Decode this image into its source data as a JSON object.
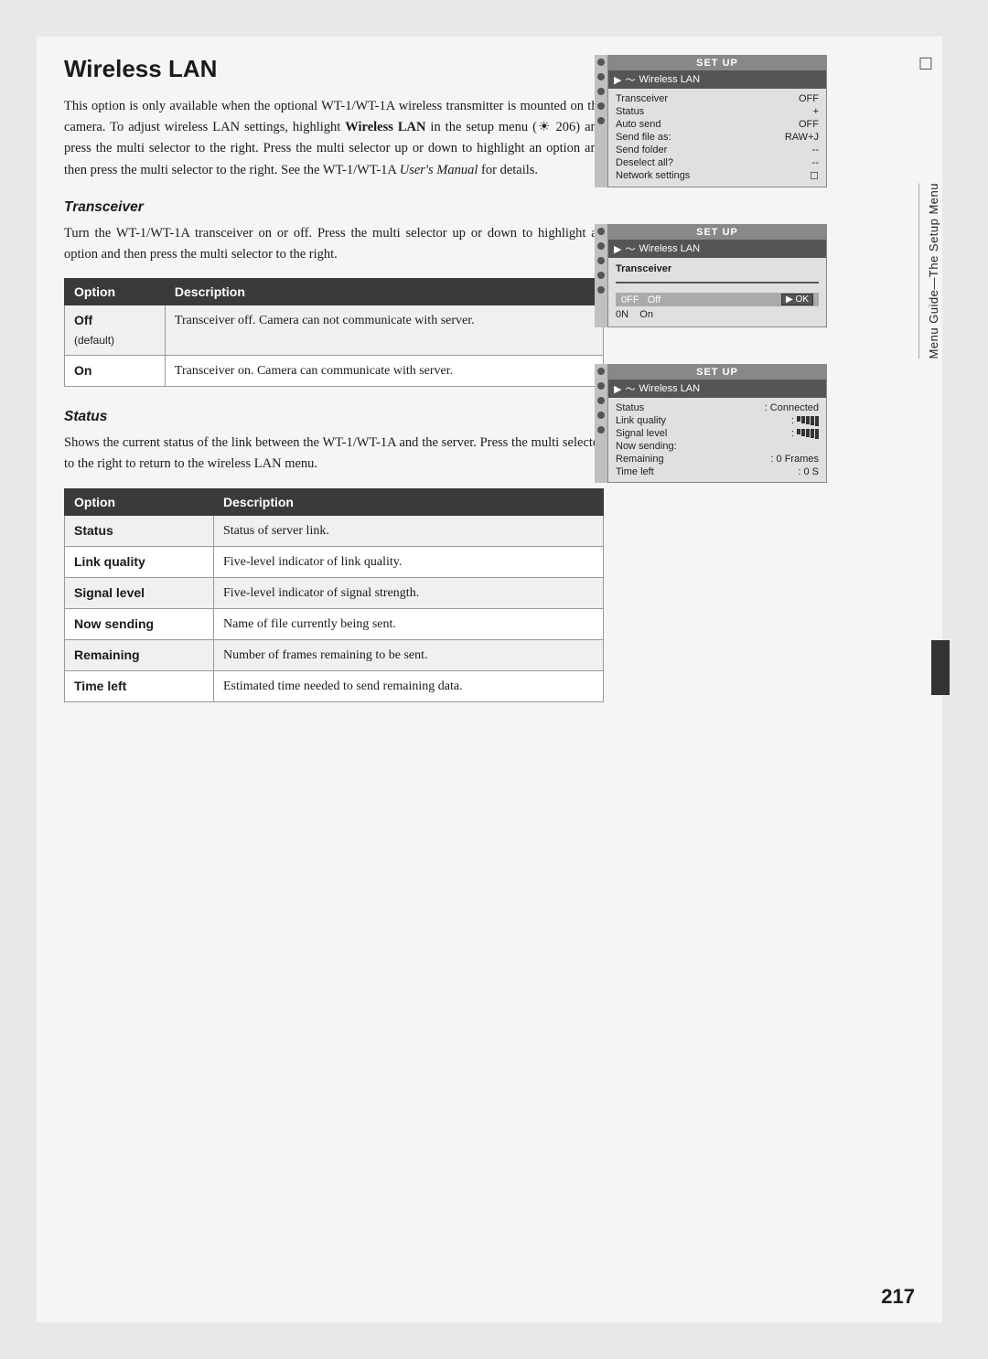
{
  "page": {
    "title": "Wireless LAN",
    "page_number": "217",
    "intro_text": "This option is only available when the optional WT-1/WT-1A wireless transmitter is mounted on the camera.  To adjust wireless LAN settings, highlight ",
    "intro_bold": "Wireless LAN",
    "intro_text2": " in the setup menu (",
    "intro_ref": "206",
    "intro_text3": ") and press the multi selector to the right.  Press the multi selector up or down to highlight an option and then press the multi selector to the right.  See the WT-1/WT-1A ",
    "intro_italic": "User's Manual",
    "intro_text4": " for details."
  },
  "transceiver_section": {
    "heading": "Transceiver",
    "body": "Turn the WT-1/WT-1A transceiver on or off.  Press the multi selector up or down to highlight an option and then press the multi selector to the right.",
    "table_headers": [
      "Option",
      "Description"
    ],
    "rows": [
      {
        "option": "Off",
        "option_note": "(default)",
        "description": "Transceiver off.  Camera can not communicate with server."
      },
      {
        "option": "On",
        "description": "Transceiver on.  Camera can communicate with server."
      }
    ]
  },
  "status_section": {
    "heading": "Status",
    "body": "Shows the current status of the link between the WT-1/WT-1A and the server.  Press the multi selector to the right to return to the wireless LAN menu.",
    "table_headers": [
      "Option",
      "Description"
    ],
    "rows": [
      {
        "option": "Status",
        "description": "Status of server link."
      },
      {
        "option": "Link quality",
        "description": "Five-level indicator of link quality."
      },
      {
        "option": "Signal level",
        "description": "Five-level indicator of signal strength."
      },
      {
        "option": "Now sending",
        "description": "Name of file currently being sent."
      },
      {
        "option": "Remaining",
        "description": "Number of frames remaining to be sent."
      },
      {
        "option": "Time left",
        "description": "Estimated time needed to send remaining data."
      }
    ]
  },
  "screenshots": {
    "screen1": {
      "header": "SET UP",
      "subheader": "Wireless LAN",
      "rows": [
        {
          "label": "Transceiver",
          "value": "OFF"
        },
        {
          "label": "Status",
          "value": "＋"
        },
        {
          "label": "Auto send",
          "value": "OFF"
        },
        {
          "label": "Send file as:",
          "value": "RAW+J"
        },
        {
          "label": "Send folder",
          "value": "--"
        },
        {
          "label": "Deselect all?",
          "value": "--"
        },
        {
          "label": "Network settings",
          "value": "☐"
        }
      ]
    },
    "screen2": {
      "header": "SET UP",
      "subheader": "Wireless LAN",
      "sub2": "Transceiver",
      "rows": [
        {
          "label": "0FF",
          "value": "Off",
          "highlighted": true
        },
        {
          "label": "0N",
          "value": "On",
          "highlighted": false
        }
      ]
    },
    "screen3": {
      "header": "SET UP",
      "subheader": "Wireless LAN",
      "rows": [
        {
          "label": "Status",
          "value": ": Connected"
        },
        {
          "label": "Link quality",
          "value": ": █████"
        },
        {
          "label": "Signal level",
          "value": ": █████"
        },
        {
          "label": "Now sending:",
          "value": ""
        },
        {
          "label": "Remaining",
          "value": ": 0 Frames"
        },
        {
          "label": "Time left",
          "value": ": 0 S"
        }
      ]
    }
  },
  "sidebar": {
    "label": "Menu Guide—The Setup Menu"
  }
}
